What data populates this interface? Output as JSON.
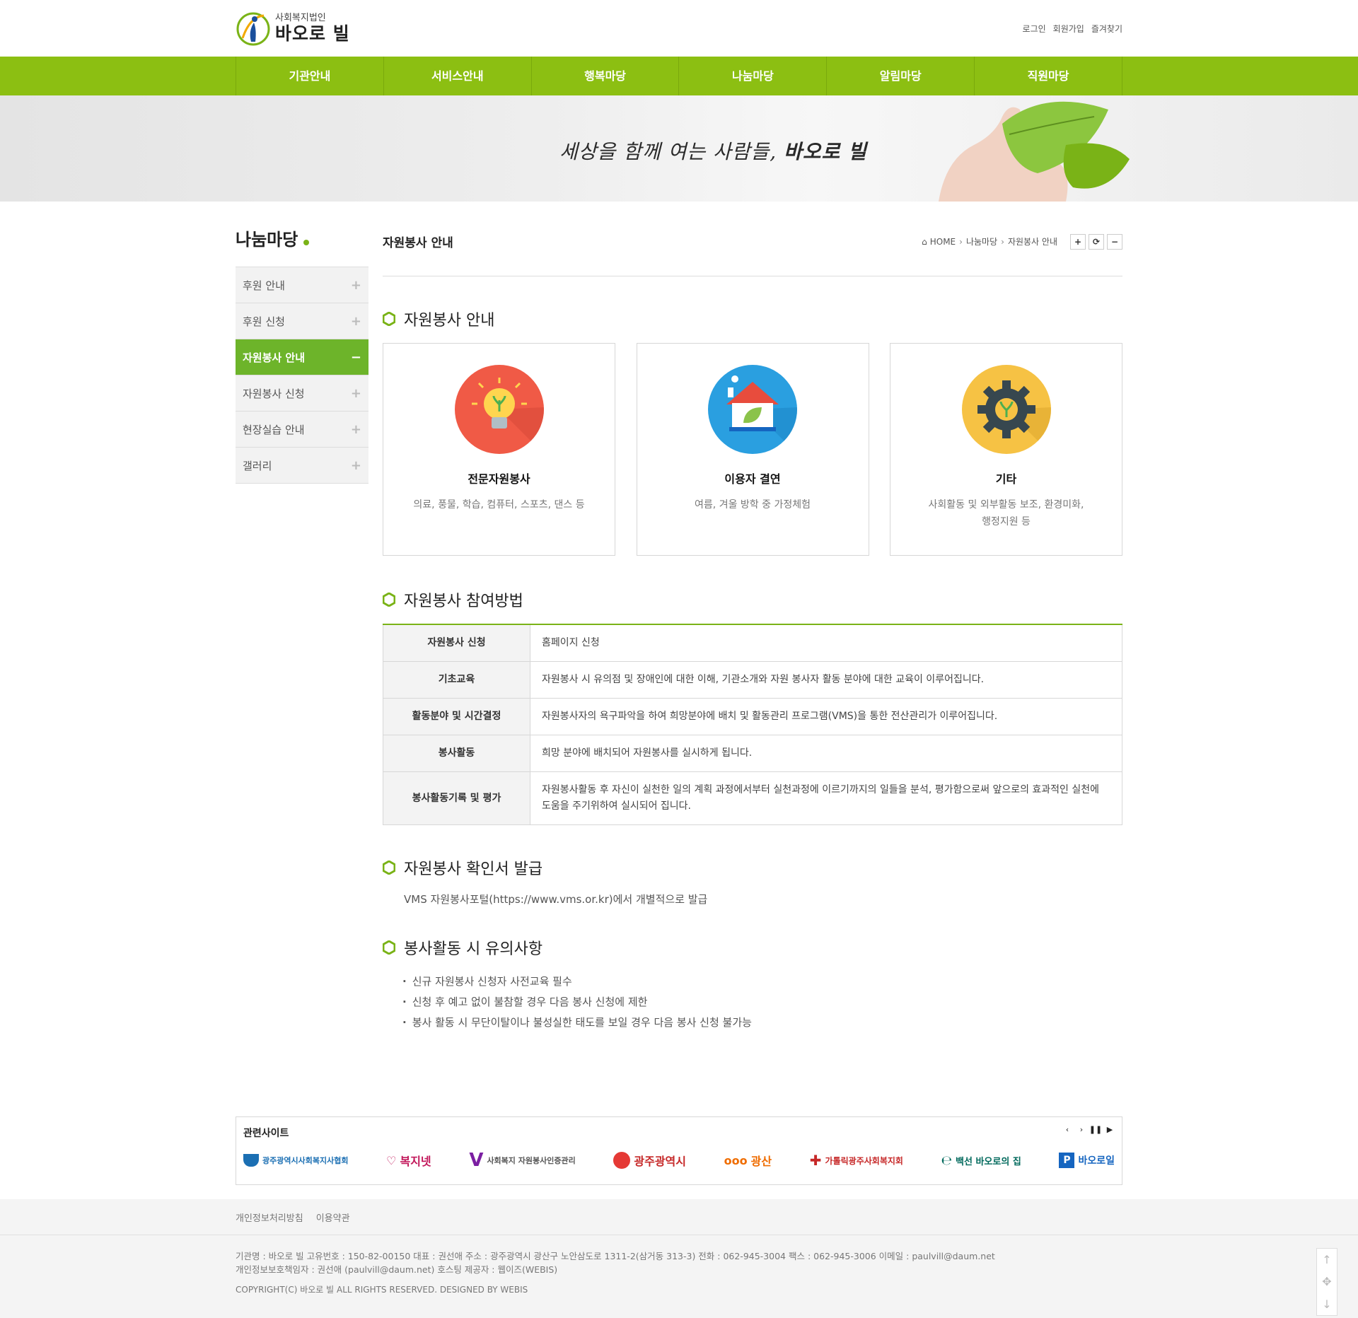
{
  "header": {
    "logo_sub": "사회복지법인",
    "logo_main": "바오로 빌",
    "util": [
      "로그인",
      "회원가입",
      "즐겨찾기"
    ]
  },
  "gnb": [
    "기관안내",
    "서비스안내",
    "행복마당",
    "나눔마당",
    "알림마당",
    "직원마당"
  ],
  "banner": {
    "slogan_prefix": "세상을 함께 여는 사람들,",
    "slogan_brand": "바오로 빌"
  },
  "lnb": {
    "title": "나눔마당",
    "items": [
      {
        "label": "후원 안내",
        "active": false
      },
      {
        "label": "후원 신청",
        "active": false
      },
      {
        "label": "자원봉사 안내",
        "active": true
      },
      {
        "label": "자원봉사 신청",
        "active": false
      },
      {
        "label": "현장실습 안내",
        "active": false
      },
      {
        "label": "갤러리",
        "active": false
      }
    ]
  },
  "page": {
    "title": "자원봉사 안내",
    "breadcrumb": [
      "HOME",
      "나눔마당",
      "자원봉사 안내"
    ],
    "tools": [
      "+",
      "⟳",
      "−"
    ]
  },
  "section1": {
    "title": "자원봉사 안내",
    "cards": [
      {
        "title": "전문자원봉사",
        "desc": "의료, 풍물, 학습, 컴퓨터, 스포츠, 댄스 등",
        "color": "#f05a46"
      },
      {
        "title": "이용자 결연",
        "desc": "여름, 겨울 방학 중 가정체험",
        "color": "#2a9fe0"
      },
      {
        "title": "기타",
        "desc": "사회활동 및 외부활동 보조, 환경미화,\n행정지원 등",
        "color": "#f6c244"
      }
    ]
  },
  "section2": {
    "title": "자원봉사 참여방법",
    "rows": [
      {
        "label": "자원봉사 신청",
        "value": "홈페이지 신청"
      },
      {
        "label": "기초교육",
        "value": "자원봉사 시 유의점 및 장애인에 대한 이해, 기관소개와 자원 봉사자 활동 분야에 대한 교육이 이루어집니다."
      },
      {
        "label": "활동분야 및 시간결정",
        "value": "자원봉사자의 욕구파악을 하여 희망분야에 배치 및 활동관리 프로그램(VMS)을 통한 전산관리가 이루어집니다."
      },
      {
        "label": "봉사활동",
        "value": "희망 분야에 배치되어 자원봉사를 실시하게 됩니다."
      },
      {
        "label": "봉사활동기록 및 평가",
        "value": "자원봉사활동 후 자신이 실천한 일의 계획 과정에서부터 실천과정에 이르기까지의 일들을 분석, 평가함으로써 앞으로의 효과적인 실천에 도움을 주기위하여 실시되어 집니다."
      }
    ]
  },
  "section3": {
    "title": "자원봉사 확인서 발급",
    "text": "VMS 자원봉사포털(https://www.vms.or.kr)에서 개별적으로 발급"
  },
  "section4": {
    "title": "봉사활동 시 유의사항",
    "items": [
      "신규 자원봉사 신청자 사전교육 필수",
      "신청 후 예고 없이 불참할 경우 다음 봉사 신청에 제한",
      "봉사 활동 시 무단이탈이나 불성실한 태도를 보일 경우 다음 봉사 신청 불가능"
    ]
  },
  "related": {
    "title": "관련사이트",
    "controls": [
      "‹",
      "›",
      "❚❚",
      "▶"
    ],
    "sites": [
      {
        "name": "광주광역시사회복지사협회",
        "color": "#1b6fb3"
      },
      {
        "name": "복지넷",
        "color": "#c2185b"
      },
      {
        "name": "사회복지 자원봉사인증관리",
        "color": "#7b1fa2"
      },
      {
        "name": "광주광역시",
        "color": "#e53935"
      },
      {
        "name": "광산",
        "color": "#ef6c00"
      },
      {
        "name": "가톨릭광주사회복지회",
        "color": "#c62828"
      },
      {
        "name": "백선 바오로의 집",
        "color": "#00695c"
      },
      {
        "name": "바오로일",
        "color": "#1565c0"
      }
    ]
  },
  "footer": {
    "links": [
      "개인정보처리방침",
      "이용약관"
    ],
    "info1": "기관명 : 바오로 빌   고유번호 : 150-82-00150   대표 : 권선애   주소 : 광주광역시 광산구 노안삼도로 1311-2(삼거동 313-3)   전화 : 062-945-3004   팩스 : 062-945-3006   이메일 : paulvill@daum.net",
    "info2": "개인정보보호책임자 : 권선애 (paulvill@daum.net)   호스팅 제공자 : 웹이즈(WEBIS)",
    "copyright": "COPYRIGHT(C) 바오로 빌 ALL RIGHTS RESERVED. DESIGNED BY WEBIS"
  }
}
